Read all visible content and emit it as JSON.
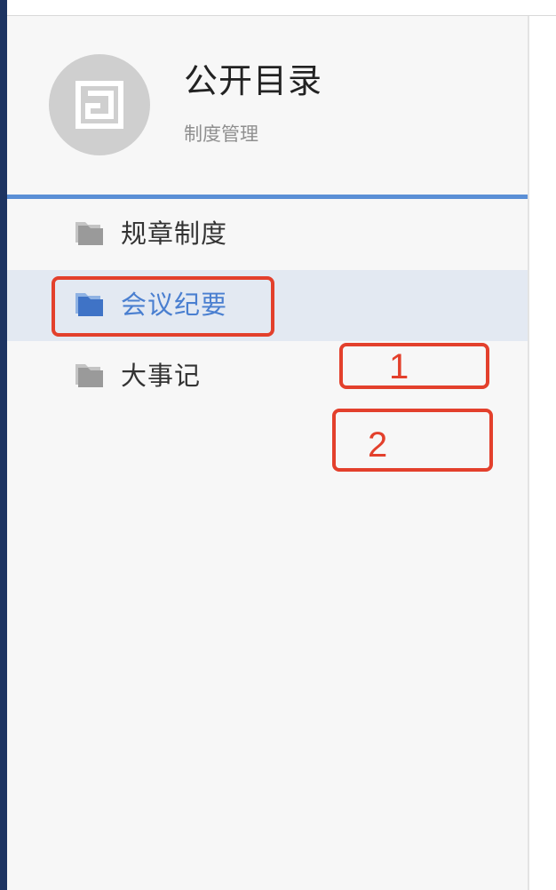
{
  "header": {
    "title": "公开目录",
    "subtitle": "制度管理",
    "avatar_icon": "document-icon"
  },
  "nav": {
    "items": [
      {
        "label": "规章制度",
        "icon": "folder-icon",
        "active": false
      },
      {
        "label": "会议纪要",
        "icon": "folder-icon",
        "active": true
      },
      {
        "label": "大事记",
        "icon": "folder-icon",
        "active": false
      }
    ]
  },
  "annotations": {
    "labels": [
      "1",
      "2"
    ]
  },
  "colors": {
    "accent": "#5b8fd6",
    "active_text": "#4a7fd0",
    "active_bg": "#e3e9f2",
    "folder_gray": "#9a9a9a",
    "folder_blue": "#3f73c6",
    "annotation_red": "#e3402c",
    "sidebar_bg": "#f7f7f7",
    "left_stripe": "#1d3461"
  }
}
